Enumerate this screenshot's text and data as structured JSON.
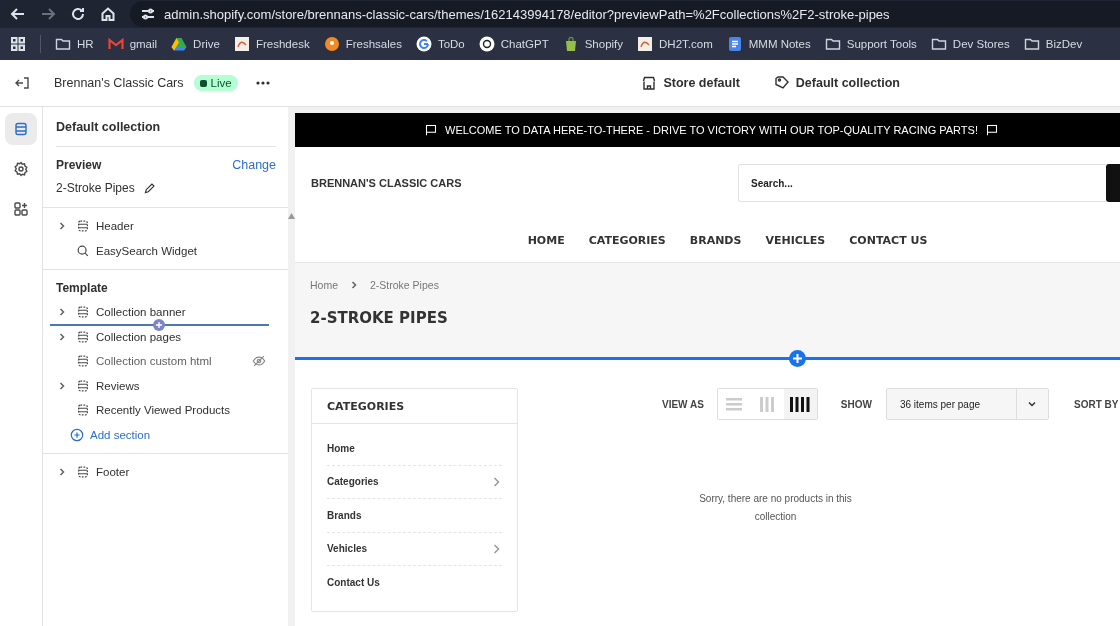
{
  "browser": {
    "url": "admin.shopify.com/store/brennans-classic-cars/themes/162143994178/editor?previewPath=%2Fcollections%2F2-stroke-pipes",
    "bookmarks": [
      "HR",
      "gmail",
      "Drive",
      "Freshdesk",
      "Freshsales",
      "ToDo",
      "ChatGPT",
      "Shopify",
      "DH2T.com",
      "MMM Notes",
      "Support Tools",
      "Dev Stores",
      "BizDev"
    ]
  },
  "editor": {
    "store_name": "Brennan's Classic Cars",
    "status": "Live",
    "context": [
      "Store default",
      "Default collection"
    ]
  },
  "rail": [
    {
      "selected": true
    },
    {
      "selected": false
    },
    {
      "selected": false
    }
  ],
  "sidebar": {
    "title": "Default collection",
    "preview_label": "Preview",
    "change_link": "Change",
    "preview_value": "2-Stroke Pipes",
    "header_group": [
      {
        "label": "Header",
        "kind": "section",
        "expandable": true,
        "hidden": false
      },
      {
        "label": "EasySearch Widget",
        "kind": "app",
        "expandable": false,
        "hidden": false
      }
    ],
    "template_title": "Template",
    "template": [
      {
        "label": "Collection banner",
        "kind": "section",
        "expandable": true,
        "hidden": false
      },
      {
        "label": "Collection pages",
        "kind": "section",
        "expandable": true,
        "hidden": false
      },
      {
        "label": "Collection custom html",
        "kind": "section",
        "expandable": false,
        "hidden": true
      },
      {
        "label": "Reviews",
        "kind": "section",
        "expandable": true,
        "hidden": false
      },
      {
        "label": "Recently Viewed Products",
        "kind": "section",
        "expandable": false,
        "hidden": false
      }
    ],
    "add_section": "Add section",
    "footer_group": [
      {
        "label": "Footer",
        "kind": "section",
        "expandable": true,
        "hidden": false
      }
    ]
  },
  "store": {
    "announcement": "WELCOME TO DATA HERE-TO-THERE - DRIVE TO VICTORY WITH OUR TOP-QUALITY RACING PARTS!",
    "logo": "BRENNAN'S CLASSIC CARS",
    "search_placeholder": "Search...",
    "nav": [
      "HOME",
      "CATEGORIES",
      "BRANDS",
      "VEHICLES",
      "CONTACT US"
    ],
    "breadcrumbs": [
      "Home",
      "2-Stroke Pipes"
    ],
    "title": "2-STROKE PIPES",
    "categories_title": "CATEGORIES",
    "categories": [
      {
        "label": "Home",
        "has_children": false
      },
      {
        "label": "Categories",
        "has_children": true
      },
      {
        "label": "Brands",
        "has_children": false
      },
      {
        "label": "Vehicles",
        "has_children": true
      },
      {
        "label": "Contact Us",
        "has_children": false
      }
    ],
    "view_as": "VIEW AS",
    "views": [
      {
        "kind": "list",
        "selected": false
      },
      {
        "kind": "grid3",
        "selected": false
      },
      {
        "kind": "grid4",
        "selected": true
      }
    ],
    "show_label": "SHOW",
    "per_page": "36 items per page",
    "sort_label": "SORT BY",
    "empty_message": "Sorry, there are no products in this collection"
  }
}
